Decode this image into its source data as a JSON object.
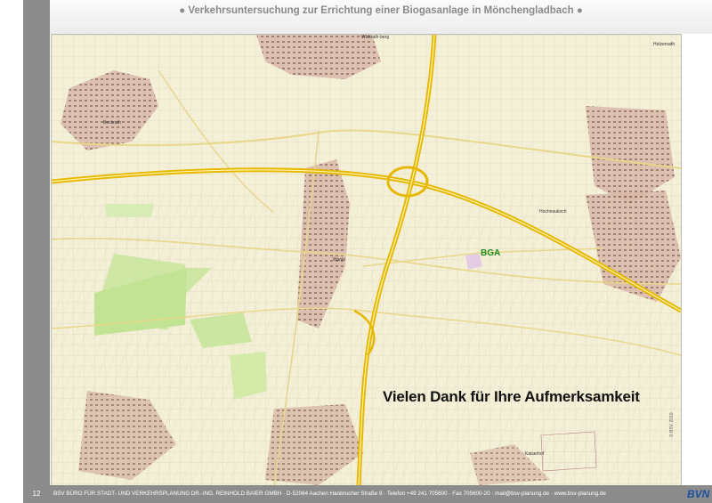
{
  "slide": {
    "number": "12",
    "title": "● Verkehrsuntersuchung zur Errichtung einer Biogasanlage in Mönchengladbach ●"
  },
  "map": {
    "place_labels": [
      {
        "name": "Wickrath-berg",
        "text": "Wickrath-berg"
      },
      {
        "name": "Beckrath",
        "text": "Beckrath"
      },
      {
        "name": "Hochneukirch",
        "text": "Hochneukirch"
      },
      {
        "name": "Wanlo",
        "text": "Wanlo"
      },
      {
        "name": "Holzenrath",
        "text": "Holzenrath"
      },
      {
        "name": "Kaiserhof",
        "text": "Kaiserhof"
      }
    ],
    "marker_label": "BGA",
    "overlay_text": "Vielen Dank für Ihre Aufmerksamkeit",
    "copyright": "© BSV 2010",
    "colors": {
      "background": "#f4efd7",
      "field_lines": "#cfc7a8",
      "settlement": "#b9a08e",
      "green": "#cbe6a0",
      "motorway": "#e6b800",
      "bga_label": "#1e8a1e"
    }
  },
  "footer": {
    "text": "BSV BÜRO FÜR STADT- UND VERKEHRSPLANUNG DR.-ING. REINHOLD BAIER GMBH  ·  D-52064 Aachen Hanbrucher Straße 9 · Telefon +49 241 705600 · Fax 705600-20 · mail@bsv-planung.de · www.bsv-planung.de",
    "logo": "BVN"
  }
}
